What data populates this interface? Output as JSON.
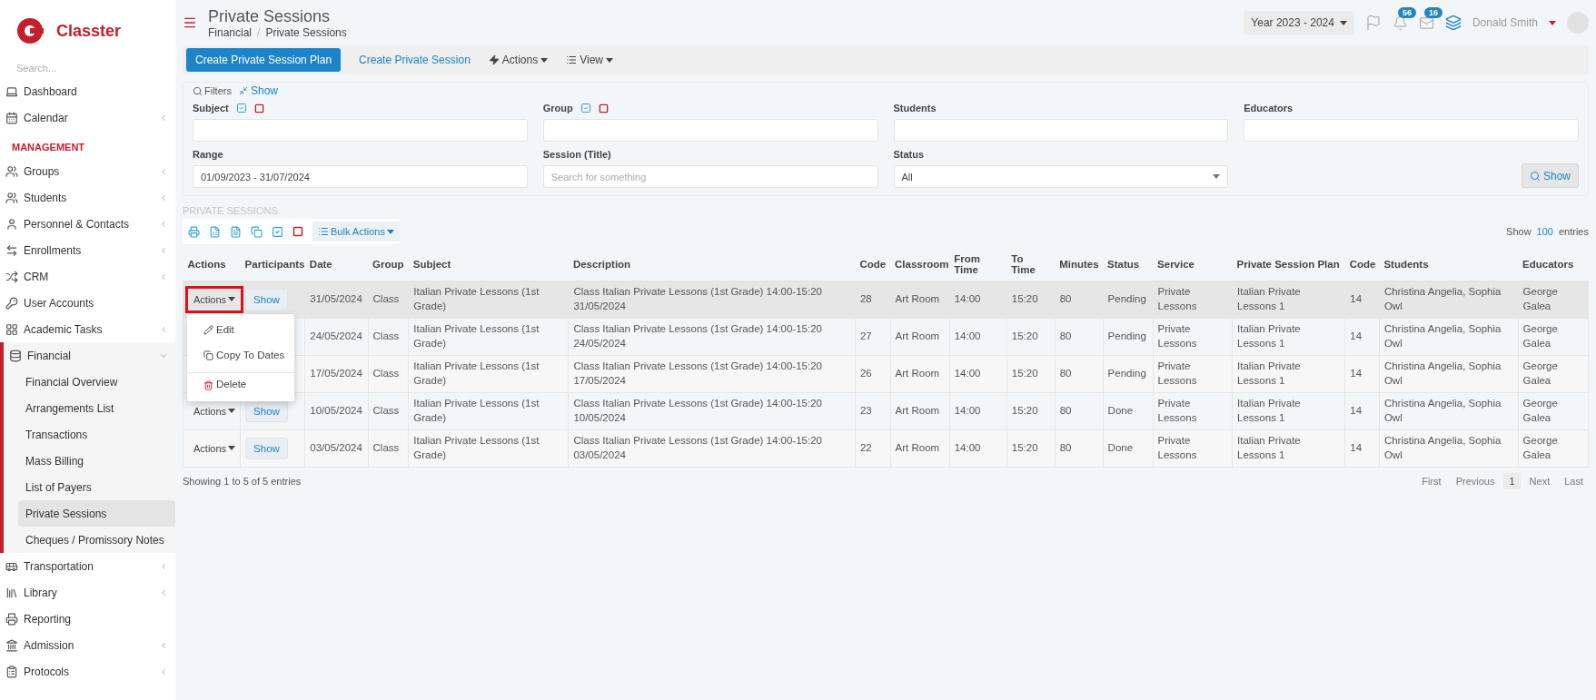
{
  "sidebar": {
    "brand": "Classter",
    "search": {
      "placeholder": "Search..."
    },
    "items": [
      {
        "kind": "link",
        "label": "Dashboard",
        "expandable": false,
        "expanded": false
      },
      {
        "kind": "link",
        "label": "Calendar",
        "expandable": true,
        "expanded": false
      },
      {
        "kind": "heading",
        "label": "MANAGEMENT"
      },
      {
        "kind": "link",
        "label": "Groups",
        "expandable": true,
        "expanded": false
      },
      {
        "kind": "link",
        "label": "Students",
        "expandable": true,
        "expanded": false
      },
      {
        "kind": "link",
        "label": "Personnel & Contacts",
        "expandable": true,
        "expanded": false
      },
      {
        "kind": "link",
        "label": "Enrollments",
        "expandable": true,
        "expanded": false
      },
      {
        "kind": "link",
        "label": "CRM",
        "expandable": true,
        "expanded": false
      },
      {
        "kind": "link",
        "label": "User Accounts",
        "expandable": false,
        "expanded": false
      },
      {
        "kind": "link",
        "label": "Academic Tasks",
        "expandable": true,
        "expanded": false
      },
      {
        "kind": "link",
        "label": "Financial",
        "expandable": true,
        "expanded": true,
        "children": [
          {
            "label": "Financial Overview",
            "selected": false
          },
          {
            "label": "Arrangements List",
            "selected": false
          },
          {
            "label": "Transactions",
            "selected": false
          },
          {
            "label": "Mass Billing",
            "selected": false
          },
          {
            "label": "List of Payers",
            "selected": false
          },
          {
            "label": "Private Sessions",
            "selected": true
          },
          {
            "label": "Cheques / Promissory Notes",
            "selected": false
          }
        ]
      },
      {
        "kind": "link",
        "label": "Transportation",
        "expandable": true,
        "expanded": false
      },
      {
        "kind": "link",
        "label": "Library",
        "expandable": true,
        "expanded": false
      },
      {
        "kind": "link",
        "label": "Reporting",
        "expandable": false,
        "expanded": false
      },
      {
        "kind": "link",
        "label": "Admission",
        "expandable": true,
        "expanded": false
      },
      {
        "kind": "link",
        "label": "Protocols",
        "expandable": true,
        "expanded": false
      }
    ]
  },
  "header": {
    "title": "Private Sessions",
    "breadcrumb": [
      "Financial",
      "Private Sessions"
    ],
    "breadcrumb_separator": "/",
    "year": "Year 2023 - 2024",
    "notifications": "56",
    "messages": "16",
    "user": "Donald Smith"
  },
  "toolbar": [
    {
      "kind": "primary",
      "label": "Create Private Session Plan"
    },
    {
      "kind": "link",
      "label": "Create Private Session"
    },
    {
      "kind": "menu",
      "label": "Actions"
    },
    {
      "kind": "view",
      "label": "View"
    }
  ],
  "filters": {
    "title": "Filters",
    "toggle": "Show",
    "button": "Show",
    "fields": [
      {
        "kind": "text",
        "label": "Subject",
        "bulk": true
      },
      {
        "kind": "text",
        "label": "Group",
        "bulk": true
      },
      {
        "kind": "text",
        "label": "Students",
        "bulk": false
      },
      {
        "kind": "text",
        "label": "Educators",
        "bulk": false
      },
      {
        "kind": "text",
        "label": "Range",
        "bulk": false,
        "value": "01/09/2023 - 31/07/2024"
      },
      {
        "kind": "text",
        "label": "Session (Title)",
        "bulk": false,
        "placeholder": "Search for something"
      },
      {
        "kind": "select",
        "label": "Status",
        "bulk": false,
        "value": "All"
      }
    ]
  },
  "table": {
    "title": "PRIVATE SESSIONS",
    "bulk_actions": "Bulk Actions",
    "show_label": "Show",
    "page_size": "100",
    "entries_label": "entries",
    "columns": [
      "Actions",
      "Participants",
      "Date",
      "Group",
      "Subject",
      "Description",
      "Code",
      "Classroom",
      "From Time",
      "To Time",
      "Minutes",
      "Status",
      "Service",
      "Private Session Plan",
      "Code",
      "Students",
      "Educators"
    ],
    "rows": [
      {
        "selected": true,
        "highlighted": true,
        "cells": [
          "Actions",
          "Show",
          "31/05/2024",
          "Class",
          "Italian Private Lessons (1st Grade)",
          "Class Italian Private Lessons (1st Grade) 14:00-15:20 31/05/2024",
          "28",
          "Art Room",
          "14:00",
          "15:20",
          "80",
          "Pending",
          "Private Lessons",
          "Italian Private Lessons 1",
          "14",
          "Christina Angelia, Sophia Owl",
          "George Galea"
        ]
      },
      {
        "selected": false,
        "cells": [
          "",
          "",
          "24/05/2024",
          "Class",
          "Italian Private Lessons (1st Grade)",
          "Class Italian Private Lessons (1st Grade) 14:00-15:20 24/05/2024",
          "27",
          "Art Room",
          "14:00",
          "15:20",
          "80",
          "Pending",
          "Private Lessons",
          "Italian Private Lessons 1",
          "14",
          "Christina Angelia, Sophia Owl",
          "George Galea"
        ]
      },
      {
        "selected": false,
        "cells": [
          "",
          "",
          "17/05/2024",
          "Class",
          "Italian Private Lessons (1st Grade)",
          "Class Italian Private Lessons (1st Grade) 14:00-15:20 17/05/2024",
          "26",
          "Art Room",
          "14:00",
          "15:20",
          "80",
          "Pending",
          "Private Lessons",
          "Italian Private Lessons 1",
          "14",
          "Christina Angelia, Sophia Owl",
          "George Galea"
        ]
      },
      {
        "selected": false,
        "highlighted": false,
        "cells": [
          "Actions",
          "Show",
          "10/05/2024",
          "Class",
          "Italian Private Lessons (1st Grade)",
          "Class Italian Private Lessons (1st Grade) 14:00-15:20 10/05/2024",
          "23",
          "Art Room",
          "14:00",
          "15:20",
          "80",
          "Done",
          "Private Lessons",
          "Italian Private Lessons 1",
          "14",
          "Christina Angelia, Sophia Owl",
          "George Galea"
        ]
      },
      {
        "selected": false,
        "highlighted": false,
        "cells": [
          "Actions",
          "Show",
          "03/05/2024",
          "Class",
          "Italian Private Lessons (1st Grade)",
          "Class Italian Private Lessons (1st Grade) 14:00-15:20 03/05/2024",
          "22",
          "Art Room",
          "14:00",
          "15:20",
          "80",
          "Done",
          "Private Lessons",
          "Italian Private Lessons 1",
          "14",
          "Christina Angelia, Sophia Owl",
          "George Galea"
        ]
      }
    ],
    "menu": [
      {
        "kind": "edit",
        "label": "Edit"
      },
      {
        "kind": "copy",
        "label": "Copy To Dates"
      },
      {
        "kind": "delete",
        "label": "Delete"
      }
    ],
    "summary": "Showing 1 to 5 of 5 entries",
    "pagination": [
      {
        "label": "First",
        "selected": false
      },
      {
        "label": "Previous",
        "selected": false
      },
      {
        "label": "1",
        "selected": true
      },
      {
        "label": "Next",
        "selected": false
      },
      {
        "label": "Last",
        "selected": false
      }
    ]
  }
}
